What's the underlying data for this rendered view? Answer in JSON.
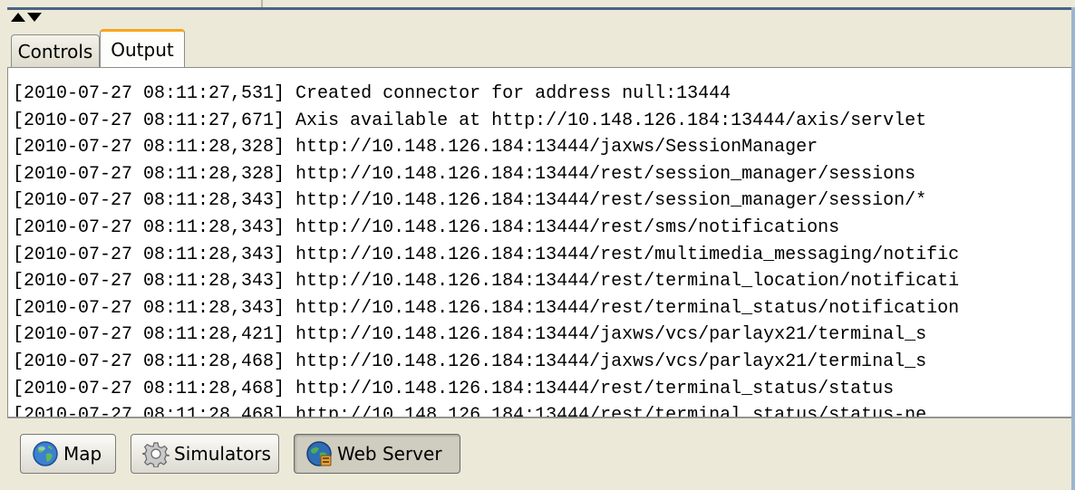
{
  "tabs": [
    {
      "label": "Controls"
    },
    {
      "label": "Output"
    }
  ],
  "active_tab": "Output",
  "log_lines": [
    "[2010-07-27 08:11:27,531] Created connector for address null:13444",
    "[2010-07-27 08:11:27,671] Axis available at http://10.148.126.184:13444/axis/servlet",
    "[2010-07-27 08:11:28,328] http://10.148.126.184:13444/jaxws/SessionManager",
    "[2010-07-27 08:11:28,328] http://10.148.126.184:13444/rest/session_manager/sessions",
    "[2010-07-27 08:11:28,343] http://10.148.126.184:13444/rest/session_manager/session/*",
    "[2010-07-27 08:11:28,343] http://10.148.126.184:13444/rest/sms/notifications",
    "[2010-07-27 08:11:28,343] http://10.148.126.184:13444/rest/multimedia_messaging/notific",
    "[2010-07-27 08:11:28,343] http://10.148.126.184:13444/rest/terminal_location/notificati",
    "[2010-07-27 08:11:28,343] http://10.148.126.184:13444/rest/terminal_status/notification",
    "[2010-07-27 08:11:28,421] http://10.148.126.184:13444/jaxws/vcs/parlayx21/terminal_s",
    "[2010-07-27 08:11:28,468] http://10.148.126.184:13444/jaxws/vcs/parlayx21/terminal_s",
    "[2010-07-27 08:11:28,468] http://10.148.126.184:13444/rest/terminal_status/status",
    "[2010-07-27 08:11:28,468] http://10.148.126.184:13444/rest/terminal_status/status-ne"
  ],
  "buttons": {
    "map": "Map",
    "simulators": "Simulators",
    "web_server": "Web Server"
  },
  "active_button": "Web Server",
  "icons": {
    "map": "globe-icon",
    "simulators": "gear-icon",
    "web_server": "web-server-globe-icon"
  }
}
